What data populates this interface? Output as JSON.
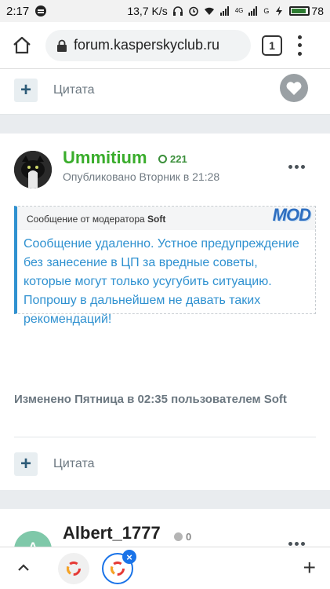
{
  "status_bar": {
    "time": "2:17",
    "speed": "13,7 K/s",
    "network": "4G",
    "signal_label": "G",
    "battery": "78"
  },
  "browser": {
    "url": "forum.kasperskyclub.ru",
    "tab_count": "1"
  },
  "posts": {
    "prev_quote_label": "Цитата",
    "main": {
      "username": "Ummitium",
      "reputation": "221",
      "posted_time": "Опубликовано Вторник в 21:28",
      "moderator_header_prefix": "Сообщение от модератора",
      "moderator_name": "Soft",
      "mod_badge": "MOD",
      "moderator_message": "Сообщение удаленно. Устное предупреждение без занесение в ЦП за вредные советы, которые могут только усугубить ситуацию. Попрошу в дальнейшем не давать таких рекомендаций!",
      "edited_note": "Изменено Пятница в 02:35 пользователем Soft",
      "quote_label": "Цитата"
    },
    "next": {
      "avatar_letter": "A",
      "username": "Albert_1777",
      "reputation": "0"
    }
  },
  "colors": {
    "accent_green": "#3aad2c",
    "mod_blue": "#2f91d0",
    "chrome_blue": "#1a73e8"
  }
}
